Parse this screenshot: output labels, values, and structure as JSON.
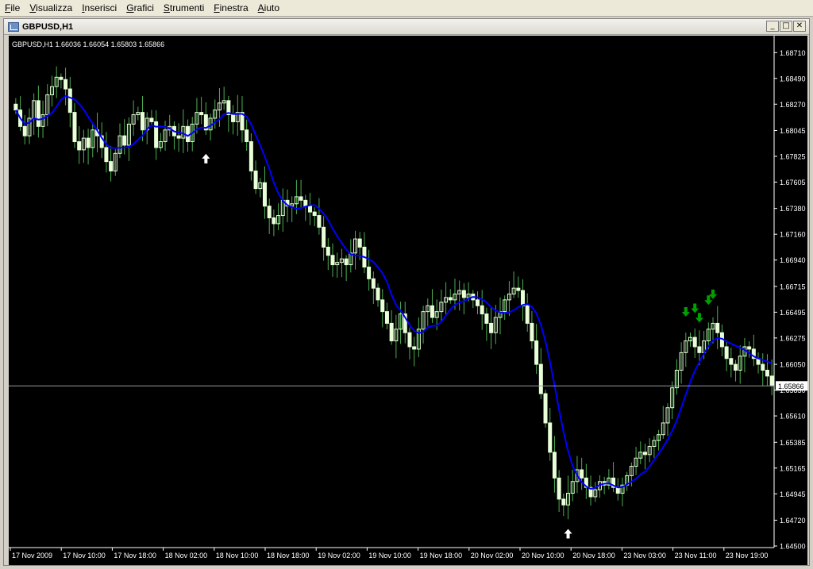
{
  "menu": [
    {
      "label": "File",
      "key": "F",
      "rest": "ile"
    },
    {
      "label": "Visualizza",
      "key": "V",
      "rest": "isualizza"
    },
    {
      "label": "Inserisci",
      "key": "I",
      "rest": "nserisci"
    },
    {
      "label": "Grafici",
      "key": "G",
      "rest": "rafici"
    },
    {
      "label": "Strumenti",
      "key": "S",
      "rest": "trumenti"
    },
    {
      "label": "Finestra",
      "key": "F",
      "rest": "inestra"
    },
    {
      "label": "Aiuto",
      "key": "A",
      "rest": "iuto"
    }
  ],
  "window": {
    "title": "GBPUSD,H1",
    "minimize": "_",
    "maximize": "□",
    "close": "✕"
  },
  "chart": {
    "info_text": "GBPUSD,H1  1.66036 1.66054 1.65803 1.65866",
    "current_price_label": "1.65866",
    "colors": {
      "background": "#000000",
      "bull": "#e8ffd8",
      "wick": "#4caf50",
      "ma": "#0000ff",
      "axis_text": "#ffffff",
      "up_arrow": "#ffffff",
      "down_arrow": "#00a000"
    }
  },
  "chart_data": {
    "type": "candlestick",
    "symbol": "GBPUSD",
    "timeframe": "H1",
    "ylim": [
      1.645,
      1.688
    ],
    "y_ticks": [
      "1.68710",
      "1.68490",
      "1.68270",
      "1.68045",
      "1.67825",
      "1.67605",
      "1.67380",
      "1.67160",
      "1.66940",
      "1.66715",
      "1.66495",
      "1.66275",
      "1.66050",
      "1.65830",
      "1.65610",
      "1.65385",
      "1.65165",
      "1.64945",
      "1.64720",
      "1.64500"
    ],
    "y_tick_values": [
      1.6871,
      1.6849,
      1.6827,
      1.68045,
      1.67825,
      1.67605,
      1.6738,
      1.6716,
      1.6694,
      1.66715,
      1.66495,
      1.66275,
      1.6605,
      1.6583,
      1.6561,
      1.65385,
      1.65165,
      1.64945,
      1.6472,
      1.645
    ],
    "x_ticks": [
      "17 Nov 2009",
      "17 Nov 10:00",
      "17 Nov 18:00",
      "18 Nov 02:00",
      "18 Nov 10:00",
      "18 Nov 18:00",
      "19 Nov 02:00",
      "19 Nov 10:00",
      "19 Nov 18:00",
      "20 Nov 02:00",
      "20 Nov 10:00",
      "20 Nov 18:00",
      "23 Nov 03:00",
      "23 Nov 11:00",
      "23 Nov 19:00"
    ],
    "current_price": 1.65866,
    "closes": [
      1.6822,
      1.6808,
      1.68,
      1.6815,
      1.683,
      1.6808,
      1.6818,
      1.6835,
      1.6842,
      1.685,
      1.6848,
      1.684,
      1.682,
      1.6795,
      1.6788,
      1.6798,
      1.679,
      1.6805,
      1.68,
      1.679,
      1.6778,
      1.677,
      1.6785,
      1.68,
      1.6792,
      1.681,
      1.6818,
      1.682,
      1.6805,
      1.6815,
      1.6812,
      1.679,
      1.6795,
      1.6805,
      1.6808,
      1.68,
      1.6798,
      1.6808,
      1.6795,
      1.681,
      1.682,
      1.6818,
      1.6805,
      1.6815,
      1.6822,
      1.6828,
      1.683,
      1.6818,
      1.6812,
      1.682,
      1.6805,
      1.6795,
      1.677,
      1.6755,
      1.676,
      1.674,
      1.673,
      1.6725,
      1.6732,
      1.6745,
      1.674,
      1.6742,
      1.6748,
      1.6745,
      1.674,
      1.6735,
      1.6732,
      1.6722,
      1.6705,
      1.6698,
      1.669,
      1.6692,
      1.6695,
      1.669,
      1.67,
      1.6712,
      1.6705,
      1.6688,
      1.6678,
      1.667,
      1.666,
      1.665,
      1.664,
      1.6625,
      1.6635,
      1.6648,
      1.6632,
      1.662,
      1.6618,
      1.6635,
      1.665,
      1.6655,
      1.6645,
      1.665,
      1.6658,
      1.6662,
      1.666,
      1.6665,
      1.6668,
      1.6662,
      1.6665,
      1.666,
      1.6655,
      1.6648,
      1.664,
      1.6632,
      1.6645,
      1.665,
      1.666,
      1.6665,
      1.667,
      1.6668,
      1.6655,
      1.664,
      1.6625,
      1.6605,
      1.658,
      1.6555,
      1.653,
      1.6508,
      1.649,
      1.6485,
      1.6495,
      1.6505,
      1.6515,
      1.6508,
      1.65,
      1.6492,
      1.6498,
      1.6505,
      1.6502,
      1.6508,
      1.65,
      1.6495,
      1.6502,
      1.651,
      1.6518,
      1.6525,
      1.653,
      1.6528,
      1.6535,
      1.654,
      1.6545,
      1.6555,
      1.6568,
      1.6585,
      1.66,
      1.6615,
      1.6625,
      1.6628,
      1.662,
      1.6615,
      1.6625,
      1.6635,
      1.664,
      1.6632,
      1.662,
      1.661,
      1.6605,
      1.66,
      1.6612,
      1.662,
      1.6618,
      1.661,
      1.6605,
      1.66,
      1.6595,
      1.6587
    ],
    "moving_average": {
      "name": "",
      "color": "#0000ff"
    },
    "up_arrow_indices": [
      42,
      122
    ],
    "down_arrow_indices": [
      148,
      150,
      151,
      153,
      154
    ]
  }
}
